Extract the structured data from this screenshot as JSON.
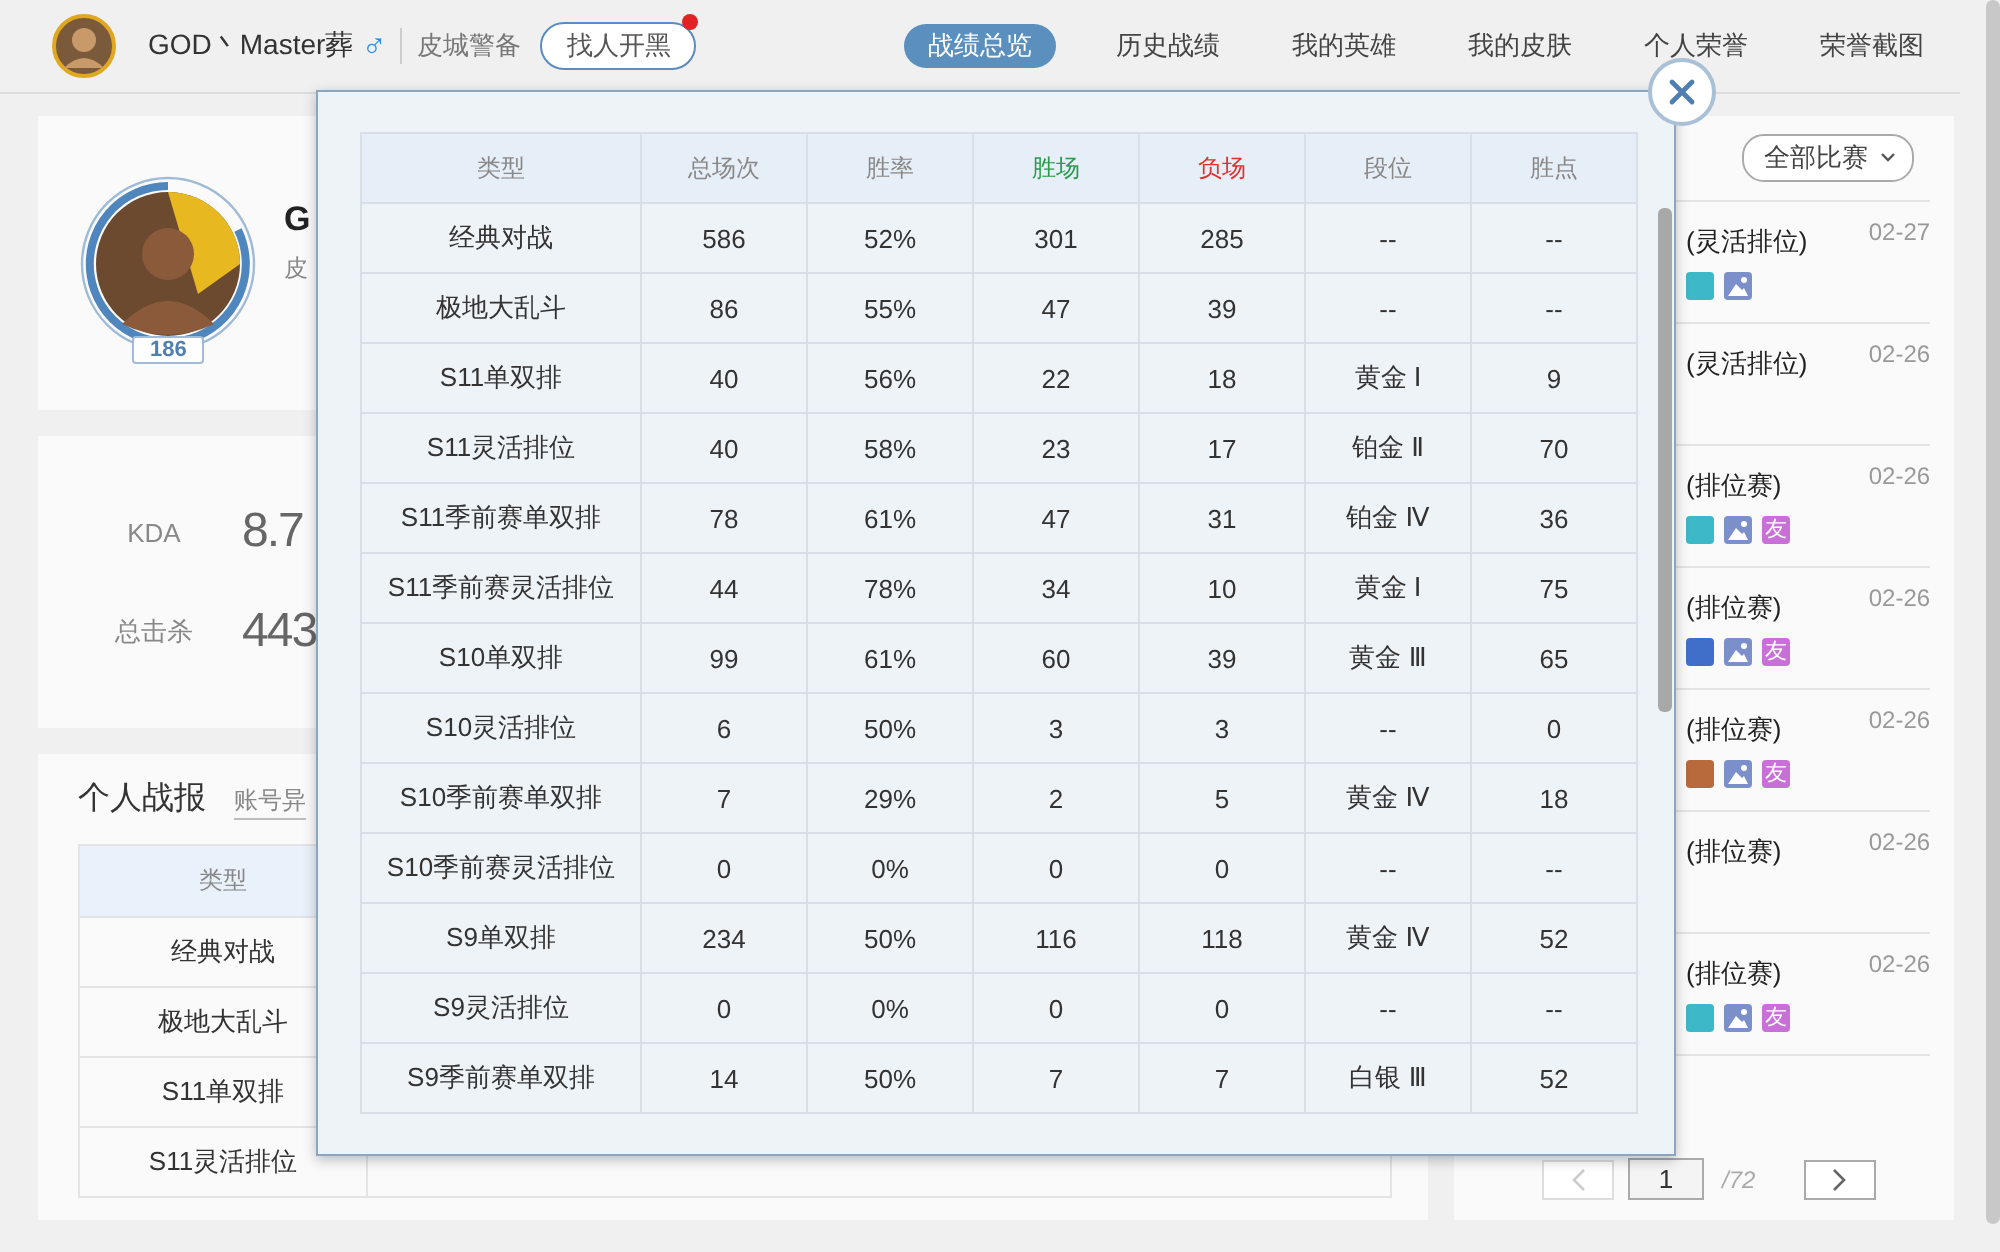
{
  "header": {
    "player_name": "GOD丶Master葬",
    "gender_symbol": "♂",
    "server": "皮城警备",
    "team_up_button": "找人开黑",
    "has_notification": true,
    "tabs": [
      {
        "label": "战绩总览",
        "selected": true
      },
      {
        "label": "历史战绩",
        "selected": false
      },
      {
        "label": "我的英雄",
        "selected": false
      },
      {
        "label": "我的皮肤",
        "selected": false
      },
      {
        "label": "个人荣誉",
        "selected": false
      },
      {
        "label": "荣誉截图",
        "selected": false
      }
    ]
  },
  "profile": {
    "level": "186",
    "name_visible": "G",
    "server_visible": "皮"
  },
  "stats": [
    {
      "label": "KDA",
      "value": "8.7"
    },
    {
      "label": "总击杀",
      "value": "443"
    }
  ],
  "report": {
    "title": "个人战报",
    "link": "账号异",
    "column": "类型",
    "rows": [
      "经典对战",
      "极地大乱斗",
      "S11单双排",
      "S11灵活排位"
    ]
  },
  "matches": {
    "filter": "全部比赛",
    "items": [
      {
        "title": "(灵活排位)",
        "date": "02-27",
        "badges": [
          {
            "kind": "tag",
            "color": "#3cb8c8"
          },
          {
            "kind": "image"
          }
        ]
      },
      {
        "title": "(灵活排位)",
        "date": "02-26"
      },
      {
        "title": "(排位赛)",
        "date": "02-26",
        "badges": [
          {
            "kind": "tag",
            "color": "#3cb8c8"
          },
          {
            "kind": "image"
          },
          {
            "kind": "friend",
            "text": "友"
          }
        ]
      },
      {
        "title": "(排位赛)",
        "date": "02-26",
        "badges": [
          {
            "kind": "tag",
            "color": "#3f6fc8"
          },
          {
            "kind": "image"
          },
          {
            "kind": "friend",
            "text": "友"
          }
        ]
      },
      {
        "title": "(排位赛)",
        "date": "02-26",
        "badges": [
          {
            "kind": "tag",
            "color": "#b86a3c"
          },
          {
            "kind": "image"
          },
          {
            "kind": "friend",
            "text": "友"
          }
        ]
      },
      {
        "title": "(排位赛)",
        "date": "02-26"
      },
      {
        "title": "(排位赛)",
        "date": "02-26",
        "badges": [
          {
            "kind": "tag",
            "color": "#3cb8c8"
          },
          {
            "kind": "image"
          },
          {
            "kind": "friend",
            "text": "友"
          }
        ]
      }
    ],
    "page": "1",
    "total_pages": "/72"
  },
  "overview_dialog": {
    "columns": [
      {
        "label": "类型",
        "kind": "plain"
      },
      {
        "label": "总场次",
        "kind": "plain"
      },
      {
        "label": "胜率",
        "kind": "plain"
      },
      {
        "label": "胜场",
        "kind": "win"
      },
      {
        "label": "负场",
        "kind": "loss"
      },
      {
        "label": "段位",
        "kind": "plain"
      },
      {
        "label": "胜点",
        "kind": "plain"
      }
    ],
    "rows": [
      [
        "经典对战",
        "586",
        "52%",
        "301",
        "285",
        "--",
        "--"
      ],
      [
        "极地大乱斗",
        "86",
        "55%",
        "47",
        "39",
        "--",
        "--"
      ],
      [
        "S11单双排",
        "40",
        "56%",
        "22",
        "18",
        "黄金 Ⅰ",
        "9"
      ],
      [
        "S11灵活排位",
        "40",
        "58%",
        "23",
        "17",
        "铂金 Ⅱ",
        "70"
      ],
      [
        "S11季前赛单双排",
        "78",
        "61%",
        "47",
        "31",
        "铂金 Ⅳ",
        "36"
      ],
      [
        "S11季前赛灵活排位",
        "44",
        "78%",
        "34",
        "10",
        "黄金 Ⅰ",
        "75"
      ],
      [
        "S10单双排",
        "99",
        "61%",
        "60",
        "39",
        "黄金 Ⅲ",
        "65"
      ],
      [
        "S10灵活排位",
        "6",
        "50%",
        "3",
        "3",
        "--",
        "0"
      ],
      [
        "S10季前赛单双排",
        "7",
        "29%",
        "2",
        "5",
        "黄金 Ⅳ",
        "18"
      ],
      [
        "S10季前赛灵活排位",
        "0",
        "0%",
        "0",
        "0",
        "--",
        "--"
      ],
      [
        "S9单双排",
        "234",
        "50%",
        "116",
        "118",
        "黄金 Ⅳ",
        "52"
      ],
      [
        "S9灵活排位",
        "0",
        "0%",
        "0",
        "0",
        "--",
        "--"
      ],
      [
        "S9季前赛单双排",
        "14",
        "50%",
        "7",
        "7",
        "白银 Ⅲ",
        "52"
      ]
    ]
  }
}
